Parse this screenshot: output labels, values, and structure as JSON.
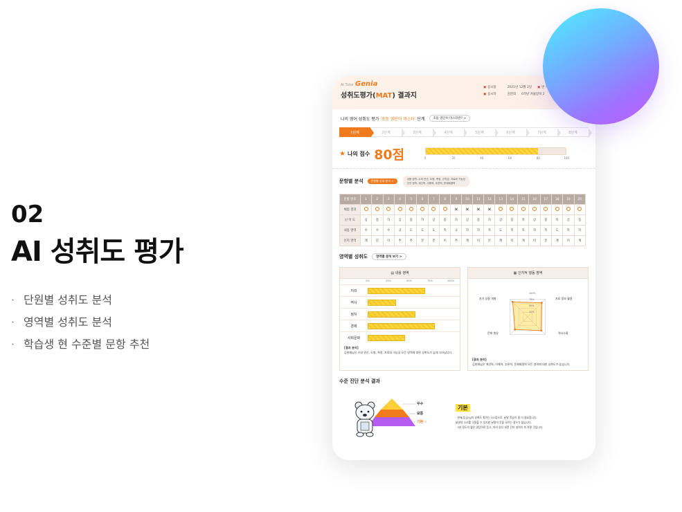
{
  "left": {
    "section_number": "02",
    "section_title": "AI 성취도 평가",
    "bullets": [
      "단원별 성취도 분석",
      "영역별 성취도 분석",
      "학습생 현 수준별 문항 추천"
    ]
  },
  "report": {
    "brand_small": "AI Tutor",
    "brand": "Genia",
    "title_pre": "성취도평가(",
    "title_em": "MAT",
    "title_post": ") 결과지",
    "meta": {
      "date_label": "응시일",
      "date_value": "2021년 12월 2일",
      "class_label": "반 이름",
      "class_value": "",
      "name_label": "응시자",
      "name_value": "김현희",
      "grade_label": "",
      "grade_value": "6학년 겨울방학 2"
    },
    "stage_text_pre": "나의 영어 성취도 평가",
    "stage_text_hl": "'초등 영단어 마스터'",
    "stage_text_post": "단계",
    "stage_button": "초등 영단어 마스터란? >",
    "steps": [
      "1단계",
      "2단계",
      "3단계",
      "4단계",
      "5단계",
      "6단계",
      "7단계",
      "8단계"
    ],
    "score_label": "나의 점수",
    "score_value": "80점",
    "score_percent": 80,
    "score_ticks": [
      "0",
      "20",
      "40",
      "60",
      "80",
      "100"
    ],
    "items_title": "문항별 분석",
    "items_button": "문항별 상세 분석 >",
    "items_note_1": "내용 영역: 수와 연산, 도형, 측정, 규칙성, 자료와 가능성",
    "items_note_2": "인지 영역: 계산력, 이해력, 추론력, 문제해결력",
    "item_row_labels": [
      "문항 번호",
      "채점 결과",
      "난 이 도",
      "내용 영역",
      "인지 영역"
    ],
    "item_results": [
      "o",
      "o",
      "o",
      "o",
      "o",
      "o",
      "o",
      "o",
      "x",
      "x",
      "x",
      "x",
      "o",
      "o",
      "o",
      "o",
      "o",
      "o",
      "o",
      "o"
    ],
    "item_difficulty": [
      "상",
      "중",
      "하",
      "상",
      "중",
      "하",
      "상",
      "중",
      "하",
      "상",
      "중",
      "하",
      "상",
      "중",
      "하",
      "상",
      "중",
      "하",
      "상",
      "중"
    ],
    "item_content": [
      "수",
      "수",
      "수",
      "규",
      "도",
      "도",
      "도",
      "측",
      "규",
      "자",
      "자",
      "측",
      "도",
      "측",
      "자",
      "자",
      "측",
      "도",
      "측",
      "자"
    ],
    "item_cognitive": [
      "계",
      "분",
      "이",
      "추",
      "추",
      "분",
      "분",
      "이",
      "추",
      "계",
      "이",
      "분",
      "계",
      "이",
      "계",
      "이",
      "분",
      "계",
      "이",
      "계"
    ],
    "domain_title": "영역별 성취도",
    "domain_button": "영역별 분석 보기 >",
    "content_panel_title": "내용 영역",
    "content_ticks": [
      "0%",
      "25%",
      "50%",
      "75%",
      "100%"
    ],
    "content_bars": [
      {
        "label": "지리",
        "value": 77
      },
      {
        "label": "역사",
        "value": 38
      },
      {
        "label": "정치",
        "value": 64
      },
      {
        "label": "경제",
        "value": 90
      },
      {
        "label": "사회문화",
        "value": 50
      }
    ],
    "content_analysis_title": "[결과 분석]",
    "content_analysis": "김현재님은 수와 연산, 도형, 측정, 자료와 가능성 모든 영역에 대한 성취도가 높게 나타납니다.",
    "cognitive_panel_title": "인지적 행동 영역",
    "cognitive_labels": [
      "자기 성찰 개발",
      "자료 정보 활용",
      "역사소통",
      "문화 향유"
    ],
    "radar_rings": [
      "100%",
      "75%",
      "50%",
      "25%"
    ],
    "radar_values": [
      0.85,
      0.8,
      0.78,
      0.72
    ],
    "cognitive_analysis_title": "[결과 분석]",
    "cognitive_analysis": "김현재님은 계산력, 이해력, 추론력, 문제해결력 모든 영역에 대한 성취도가 높습니다.",
    "level_title": "수준 진단 분석 결과",
    "levels": [
      "우수",
      "보통",
      "기본"
    ],
    "current_level": "기본",
    "level_badge": "기본",
    "level_desc": [
      "· 현재(등급)님의 성취도 평가는 OO점으로, 낱말 학습이 좀 더 필요합니다.",
      "낱말의 소리를 익혔을 수 있지만 낱말의 뜻을 모르는 경우가 많습니다.",
      "· 3분 정도의 짧은 영단어로 듣고, 따라 읽다 보면 단어 실력이 쑥 자랄 것입니다."
    ]
  },
  "colors": {
    "accent": "#f07b1e",
    "bar": "#ffd63b",
    "orb_start": "#4ff0ff",
    "orb_end": "#c060ff"
  }
}
